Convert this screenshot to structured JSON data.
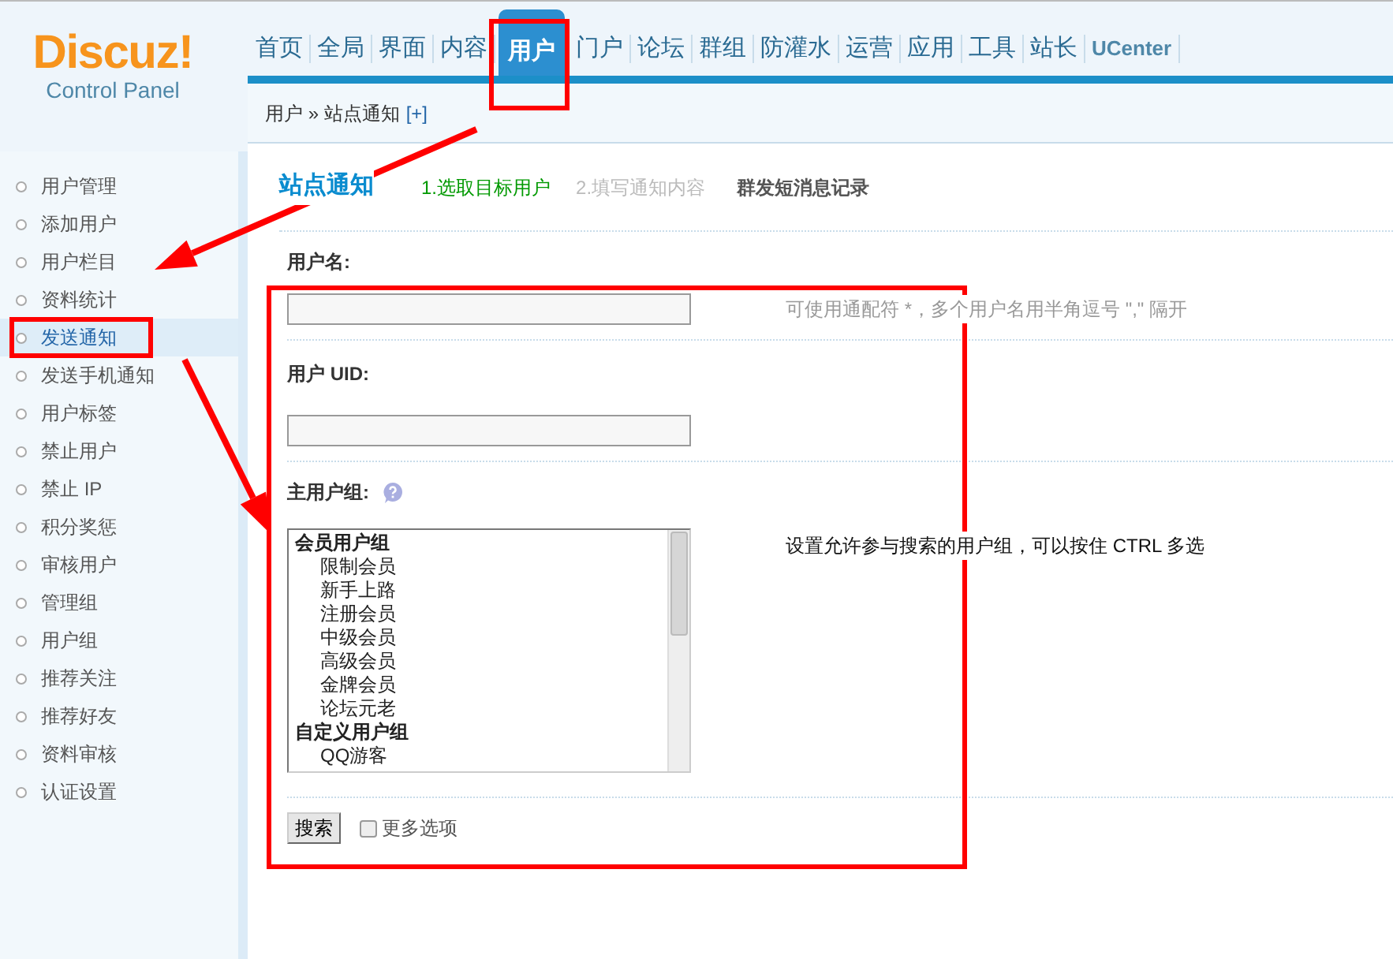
{
  "logo": {
    "name": "Discuz!",
    "subtitle": "Control Panel"
  },
  "nav": [
    {
      "label": "首页",
      "selected": false
    },
    {
      "label": "全局",
      "selected": false
    },
    {
      "label": "界面",
      "selected": false
    },
    {
      "label": "内容",
      "selected": false
    },
    {
      "label": "用户",
      "selected": true
    },
    {
      "label": "门户",
      "selected": false
    },
    {
      "label": "论坛",
      "selected": false
    },
    {
      "label": "群组",
      "selected": false
    },
    {
      "label": "防灌水",
      "selected": false
    },
    {
      "label": "运营",
      "selected": false
    },
    {
      "label": "应用",
      "selected": false
    },
    {
      "label": "工具",
      "selected": false
    },
    {
      "label": "站长",
      "selected": false
    },
    {
      "label": "UCenter",
      "selected": false
    }
  ],
  "breadcrumb": {
    "path": "用户 » 站点通知",
    "add": "[+]"
  },
  "sidebar": {
    "items": [
      {
        "label": "用户管理",
        "selected": false
      },
      {
        "label": "添加用户",
        "selected": false
      },
      {
        "label": "用户栏目",
        "selected": false
      },
      {
        "label": "资料统计",
        "selected": false
      },
      {
        "label": "发送通知",
        "selected": true
      },
      {
        "label": "发送手机通知",
        "selected": false
      },
      {
        "label": "用户标签",
        "selected": false
      },
      {
        "label": "禁止用户",
        "selected": false
      },
      {
        "label": "禁止 IP",
        "selected": false
      },
      {
        "label": "积分奖惩",
        "selected": false
      },
      {
        "label": "审核用户",
        "selected": false
      },
      {
        "label": "管理组",
        "selected": false
      },
      {
        "label": "用户组",
        "selected": false
      },
      {
        "label": "推荐关注",
        "selected": false
      },
      {
        "label": "推荐好友",
        "selected": false
      },
      {
        "label": "资料审核",
        "selected": false
      },
      {
        "label": "认证设置",
        "selected": false
      }
    ]
  },
  "page": {
    "title": "站点通知",
    "steps": [
      {
        "label": "1.选取目标用户",
        "selected": true
      },
      {
        "label": "2.填写通知内容",
        "selected": false
      }
    ],
    "history_link": "群发短消息记录"
  },
  "form": {
    "username": {
      "label": "用户名:",
      "hint": "可使用通配符 *，多个用户名用半角逗号 \",\" 隔开"
    },
    "uid": {
      "label": "用户 UID:"
    },
    "group": {
      "label": "主用户组:",
      "hint": "设置允许参与搜索的用户组，可以按住 CTRL 多选",
      "options": [
        {
          "kind": "group",
          "label": "会员用户组"
        },
        {
          "kind": "option",
          "label": "限制会员"
        },
        {
          "kind": "option",
          "label": "新手上路"
        },
        {
          "kind": "option",
          "label": "注册会员"
        },
        {
          "kind": "option",
          "label": "中级会员"
        },
        {
          "kind": "option",
          "label": "高级会员"
        },
        {
          "kind": "option",
          "label": "金牌会员"
        },
        {
          "kind": "option",
          "label": "论坛元老"
        },
        {
          "kind": "group",
          "label": "自定义用户组"
        },
        {
          "kind": "option",
          "label": "QQ游客"
        }
      ]
    },
    "search_button": "搜索",
    "more_options": {
      "label": "更多选项",
      "checked": false
    }
  }
}
